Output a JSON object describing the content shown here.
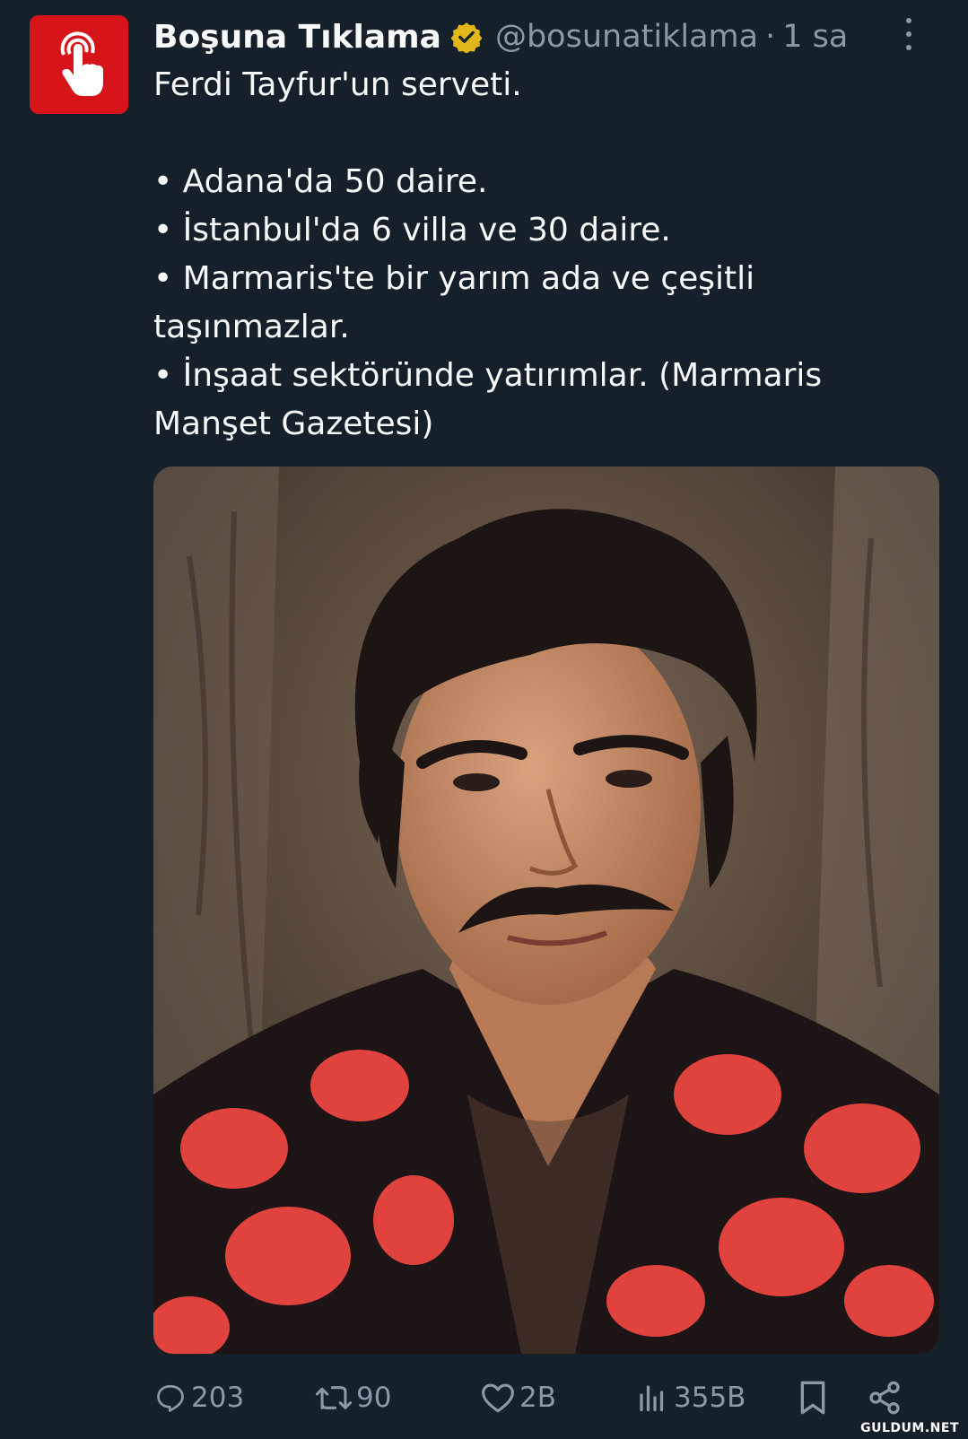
{
  "author": {
    "display_name": "Boşuna Tıklama",
    "handle": "@bosunatiklama",
    "separator": "·",
    "time": "1 sa",
    "verified": true,
    "avatar_color": "#d8141b"
  },
  "tweet": {
    "lines": [
      "Ferdi Tayfur'un serveti.",
      "",
      "• Adana'da 50 daire.",
      "• İstanbul'da 6 villa ve 30 daire.",
      "• Marmaris'te bir yarım ada ve çeşitli",
      "taşınmazlar.",
      "• İnşaat sektöründe yatırımlar. (Marmaris",
      "Manşet Gazetesi)"
    ]
  },
  "actions": {
    "replies": "203",
    "retweets": "90",
    "likes": "2B",
    "views": "355B"
  },
  "watermark": "GULDUM.NET",
  "colors": {
    "background": "#15202b",
    "text": "#f7f9f9",
    "muted": "#8b98a5",
    "verified_gold": "#e2b719"
  }
}
